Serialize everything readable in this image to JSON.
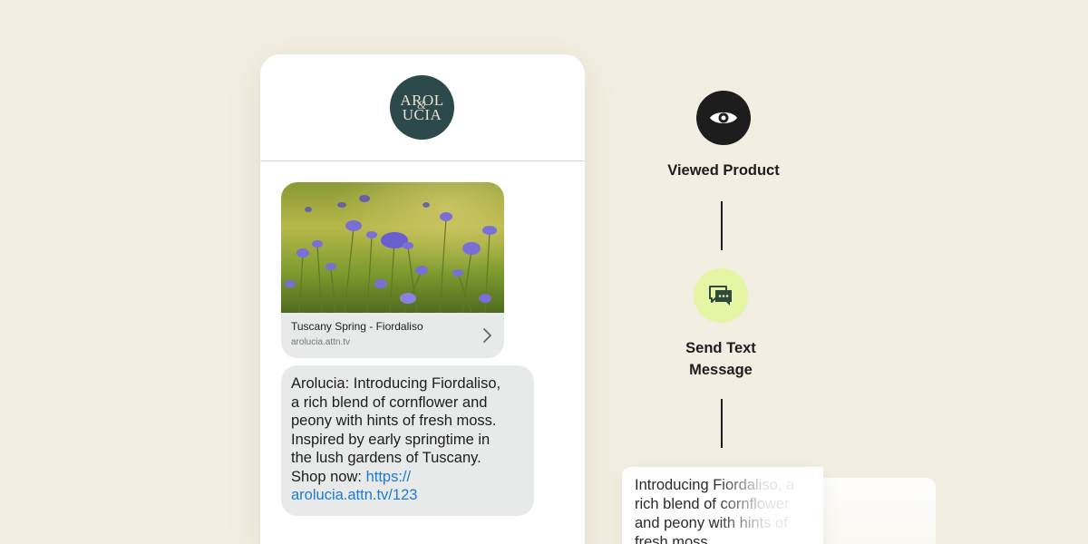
{
  "phone": {
    "logo": {
      "line1": "AROL",
      "line2": "UCIA",
      "ampersand": "&",
      "bg_color": "#2c4a4b"
    },
    "link_preview": {
      "image": "cornflower-field-photo",
      "title": "Tuscany Spring - Fiordaliso",
      "url": "arolucia.attn.tv",
      "icon": "chevron-right-icon"
    },
    "message": {
      "lines": [
        "Arolucia: Introducing Fiordaliso,",
        "a rich blend of cornflower and",
        "peony with hints of fresh moss.",
        "Inspired by early springtime in",
        "the lush gardens of Tuscany."
      ],
      "shop_prefix": "Shop now: ",
      "link_part1": "https://",
      "link_part2": "arolucia.attn.tv/123",
      "link_color": "#1b7bd6"
    }
  },
  "flow": {
    "step1": {
      "icon": "eye-icon",
      "label": "Viewed Product",
      "icon_bg": "#1d1d1d"
    },
    "step2": {
      "icon": "message-bubbles-icon",
      "label_line1": "Send Text",
      "label_line2": "Message",
      "icon_bg": "#e4f5a4"
    },
    "preview": {
      "lines": [
        "Introducing Fiordaliso, a",
        "rich blend of cornflower",
        "and peony with hints of",
        "fresh moss."
      ]
    }
  }
}
